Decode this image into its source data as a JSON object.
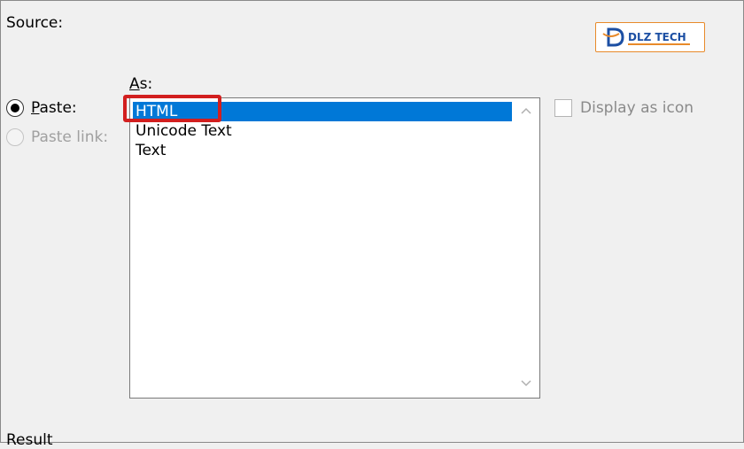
{
  "dialog": {
    "source_label": "Source:",
    "as_label_first": "A",
    "as_label_rest": "s:",
    "paste_option": {
      "underlined": "P",
      "rest": "aste:",
      "checked": true
    },
    "paste_link_option": {
      "label": "Paste link:",
      "enabled": false
    },
    "formats": [
      {
        "label": "HTML",
        "selected": true
      },
      {
        "label": "Unicode Text",
        "selected": false
      },
      {
        "label": "Text",
        "selected": false
      }
    ],
    "display_as_icon": {
      "label": "Display as icon",
      "checked": false,
      "enabled": false
    },
    "result_label": "Result"
  },
  "logo": {
    "text": "DLZ TECH",
    "brand_color": "#1c4fa3",
    "border_color": "#e88a2a"
  },
  "colors": {
    "selection": "#0078d7",
    "annotation": "#d21f1f"
  }
}
